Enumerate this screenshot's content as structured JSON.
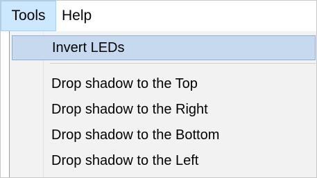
{
  "menubar": {
    "items": [
      {
        "label": "Tools",
        "active": true
      },
      {
        "label": "Help",
        "active": false
      }
    ]
  },
  "tools_menu": {
    "items": [
      {
        "label": "Invert LEDs",
        "highlighted": true
      },
      {
        "label": "Drop shadow to the Top"
      },
      {
        "label": "Drop shadow to the Right"
      },
      {
        "label": "Drop shadow to the Bottom"
      },
      {
        "label": "Drop shadow to the Left"
      }
    ]
  },
  "colors": {
    "menubar_active_bg": "#cce8ff",
    "menu_highlight_bg": "#c6d9ee",
    "menu_bg": "#f2f2f2"
  }
}
